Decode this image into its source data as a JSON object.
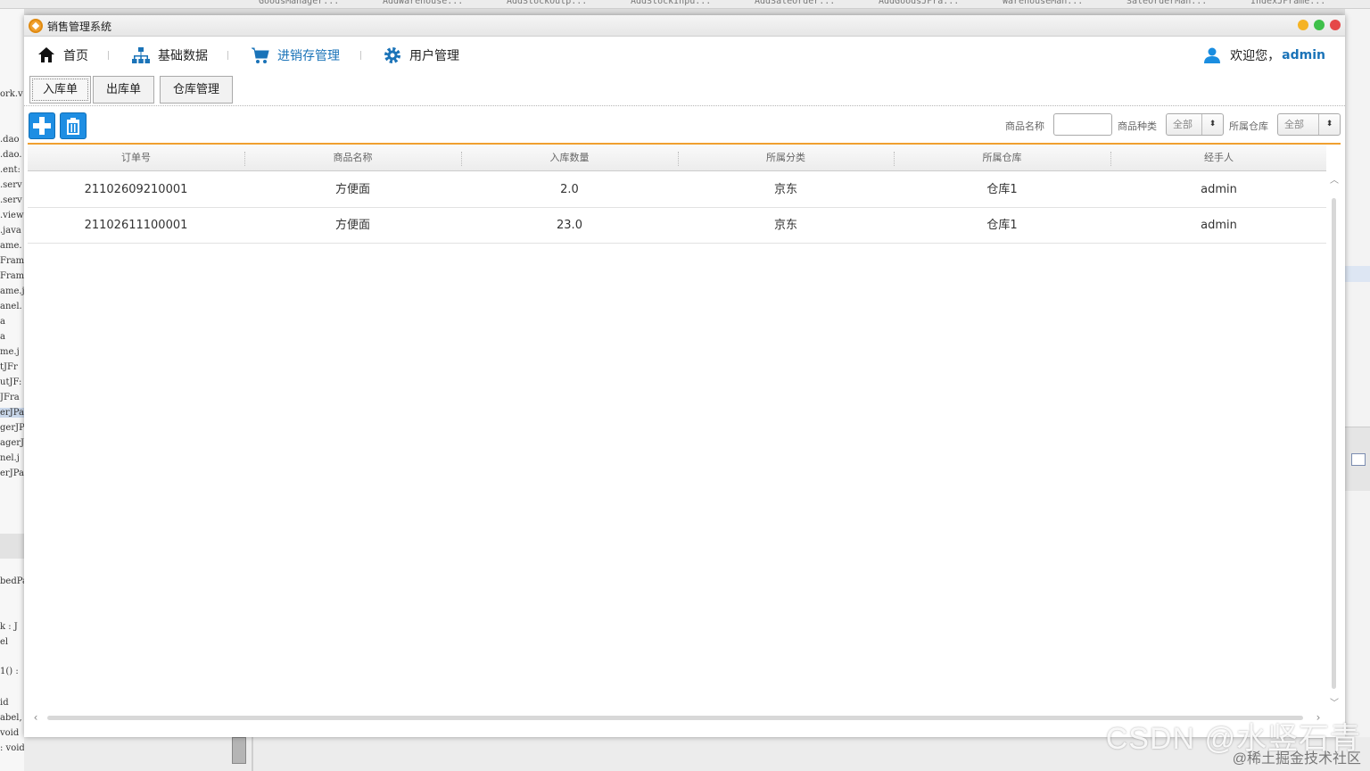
{
  "window": {
    "title": "销售管理系统"
  },
  "nav": {
    "items": [
      {
        "label": "首页",
        "icon": "home-icon"
      },
      {
        "label": "基础数据",
        "icon": "sitemap-icon"
      },
      {
        "label": "进销存管理",
        "icon": "cart-icon",
        "active": true
      },
      {
        "label": "用户管理",
        "icon": "gear-icon"
      }
    ],
    "welcome": "欢迎您，",
    "username": "admin",
    "accent_color": "#1a73b8"
  },
  "subtabs": [
    {
      "label": "入库单",
      "selected": true
    },
    {
      "label": "出库单"
    },
    {
      "label": "仓库管理"
    }
  ],
  "toolbar": {
    "add_icon": "plus-icon",
    "delete_icon": "trash-icon",
    "button_color": "#1e8ee3"
  },
  "filters": {
    "name_label": "商品名称",
    "name_value": "",
    "category_label": "商品种类",
    "category_value": "全部",
    "warehouse_label": "所属仓库",
    "warehouse_value": "全部"
  },
  "table": {
    "columns": [
      "订单号",
      "商品名称",
      "入库数量",
      "所属分类",
      "所属仓库",
      "经手人"
    ],
    "rows": [
      [
        "21102609210001",
        "方便面",
        "2.0",
        "京东",
        "仓库1",
        "admin"
      ],
      [
        "21102611100001",
        "方便面",
        "23.0",
        "京东",
        "仓库1",
        "admin"
      ]
    ],
    "header_accent": "#f0a030"
  },
  "watermark": {
    "line1": "CSDN @水竖石青",
    "line2": "@稀土掘金技术社区"
  },
  "background": {
    "tabs": [
      "GoodsManager...",
      "AddWarehouse...",
      "AddStockOutp...",
      "AddStockInpu...",
      "AddSaleOrder...",
      "AddGoodsJFra...",
      "WarehouseMan...",
      "SaleOrderMan...",
      "IndexJFrame..."
    ],
    "code_lines": [
      "ork.v",
      ".dao",
      ".dao.",
      ".ent:",
      ".serv",
      ".serv",
      ".view",
      ".java",
      "ame.",
      "Frame",
      "Fram",
      "ame.j",
      "anel.",
      "a",
      "a",
      "me.j",
      "tJFr",
      "utJF:",
      "JFra",
      "erJPa",
      "gerJP",
      "agerJ",
      "nel.j",
      "erJPa",
      "bedPa",
      "k : J",
      "el",
      "1() :",
      "id",
      "abel,",
      "void",
      ": void"
    ]
  }
}
